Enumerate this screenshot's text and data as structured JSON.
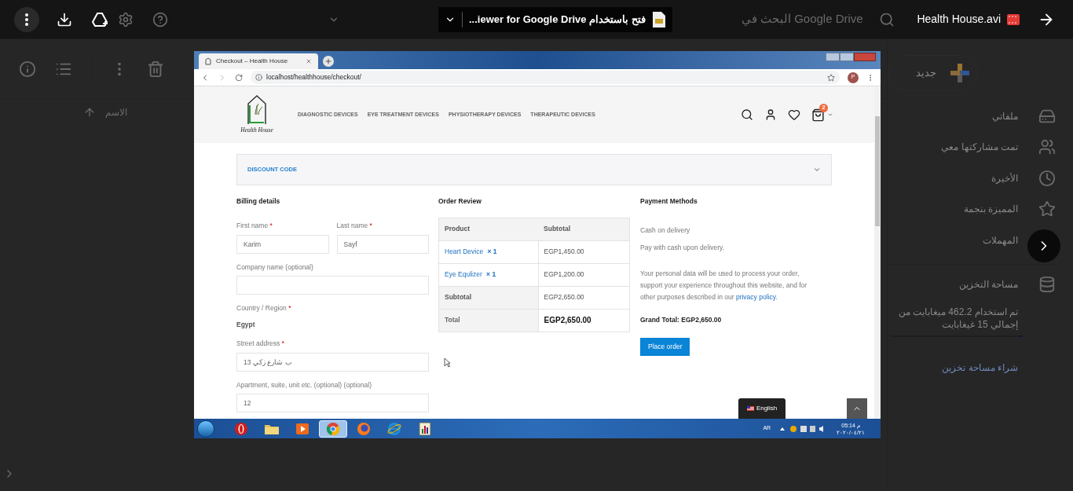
{
  "viewer": {
    "file_name": "Health House.avi",
    "open_with_app": "...iewer for Google Drive",
    "open_with_prefix": "فتح باستخدام"
  },
  "drive": {
    "search_placeholder": "البحث في Google Drive",
    "sort_column": "الاسم",
    "new_button": "جديد",
    "nav": [
      {
        "label": "ملفاتي",
        "kind": "drive"
      },
      {
        "label": "تمت مشاركتها معي",
        "kind": "shared"
      },
      {
        "label": "الأخيرة",
        "kind": "recent"
      },
      {
        "label": "المميزة بنجمة",
        "kind": "starred"
      },
      {
        "label": "المهملات",
        "kind": "trash"
      }
    ],
    "storage": {
      "label": "مساحة التخزين",
      "usage": "تم استخدام 462.2 ميغابايت من إجمالي 15 غيغابايت",
      "level": 0.03,
      "buy": "شراء مساحة تخزين"
    }
  },
  "video": {
    "browser": {
      "tab_title": "Checkout – Health House",
      "url": "localhost/healthhouse/checkout/",
      "profile": "P"
    },
    "site": {
      "logo_text": "Health House",
      "nav": [
        "DIAGNOSTIC DEVICES",
        "EYE TREATMENT DEVICES",
        "PHYSIOTHERAPY DEVICES",
        "THERAPEUTIC DEVICES"
      ],
      "cart_count": "2",
      "discount": "DISCOUNT CODE",
      "billing": {
        "title": "Billing details",
        "required_mark": "*",
        "fields": [
          {
            "kind": "pair",
            "items": [
              {
                "label": "First name",
                "required": true,
                "value": "Karim"
              },
              {
                "label": "Last name",
                "required": true,
                "value": "Sayf"
              }
            ]
          },
          {
            "kind": "input",
            "label": "Company name (optional)",
            "required": false
          },
          {
            "kind": "static",
            "label": "Country / Region",
            "required": true,
            "value": "Egypt"
          },
          {
            "kind": "input",
            "label": "Street address",
            "required": true,
            "value": "ب شارع زكي 13"
          },
          {
            "kind": "input",
            "label": "Apartment, suite, unit etc. (optional) (optional)",
            "required": false,
            "value": "12"
          }
        ]
      },
      "order": {
        "title": "Order Review",
        "columns": [
          "Product",
          "Subtotal"
        ],
        "items": [
          {
            "name": "Heart Device",
            "qty": "× 1",
            "price": "EGP1,450.00"
          },
          {
            "name": "Eye Equlizer",
            "qty": "× 1",
            "price": "EGP1,200.00"
          }
        ],
        "subtotal": {
          "label": "Subtotal",
          "value": "EGP2,650.00"
        },
        "total": {
          "label": "Total",
          "value": "EGP2,650.00"
        }
      },
      "payment": {
        "title": "Payment Methods",
        "method": "Cash on delivery",
        "method_note": "Pay with cash upon delivery.",
        "privacy_text": "Your personal data will be used to process your order, support your experience throughout this website, and for other purposes described in our",
        "privacy_link": "privacy policy",
        "privacy_end": ".",
        "grand_total_label": "Grand Total:",
        "grand_total_value": "EGP2,650.00",
        "button": "Place order"
      },
      "language": "English"
    },
    "taskbar": {
      "apps": [
        {
          "kind": "opera",
          "selected": false
        },
        {
          "kind": "folder",
          "selected": false
        },
        {
          "kind": "player",
          "selected": false
        },
        {
          "kind": "chrome",
          "selected": true
        },
        {
          "kind": "firefox",
          "selected": false
        },
        {
          "kind": "ie",
          "selected": false
        },
        {
          "kind": "chart",
          "selected": false
        }
      ],
      "lang": "AR",
      "time": "05:14 م",
      "date": "٢٠٢٠/٠٤/٢١"
    }
  }
}
